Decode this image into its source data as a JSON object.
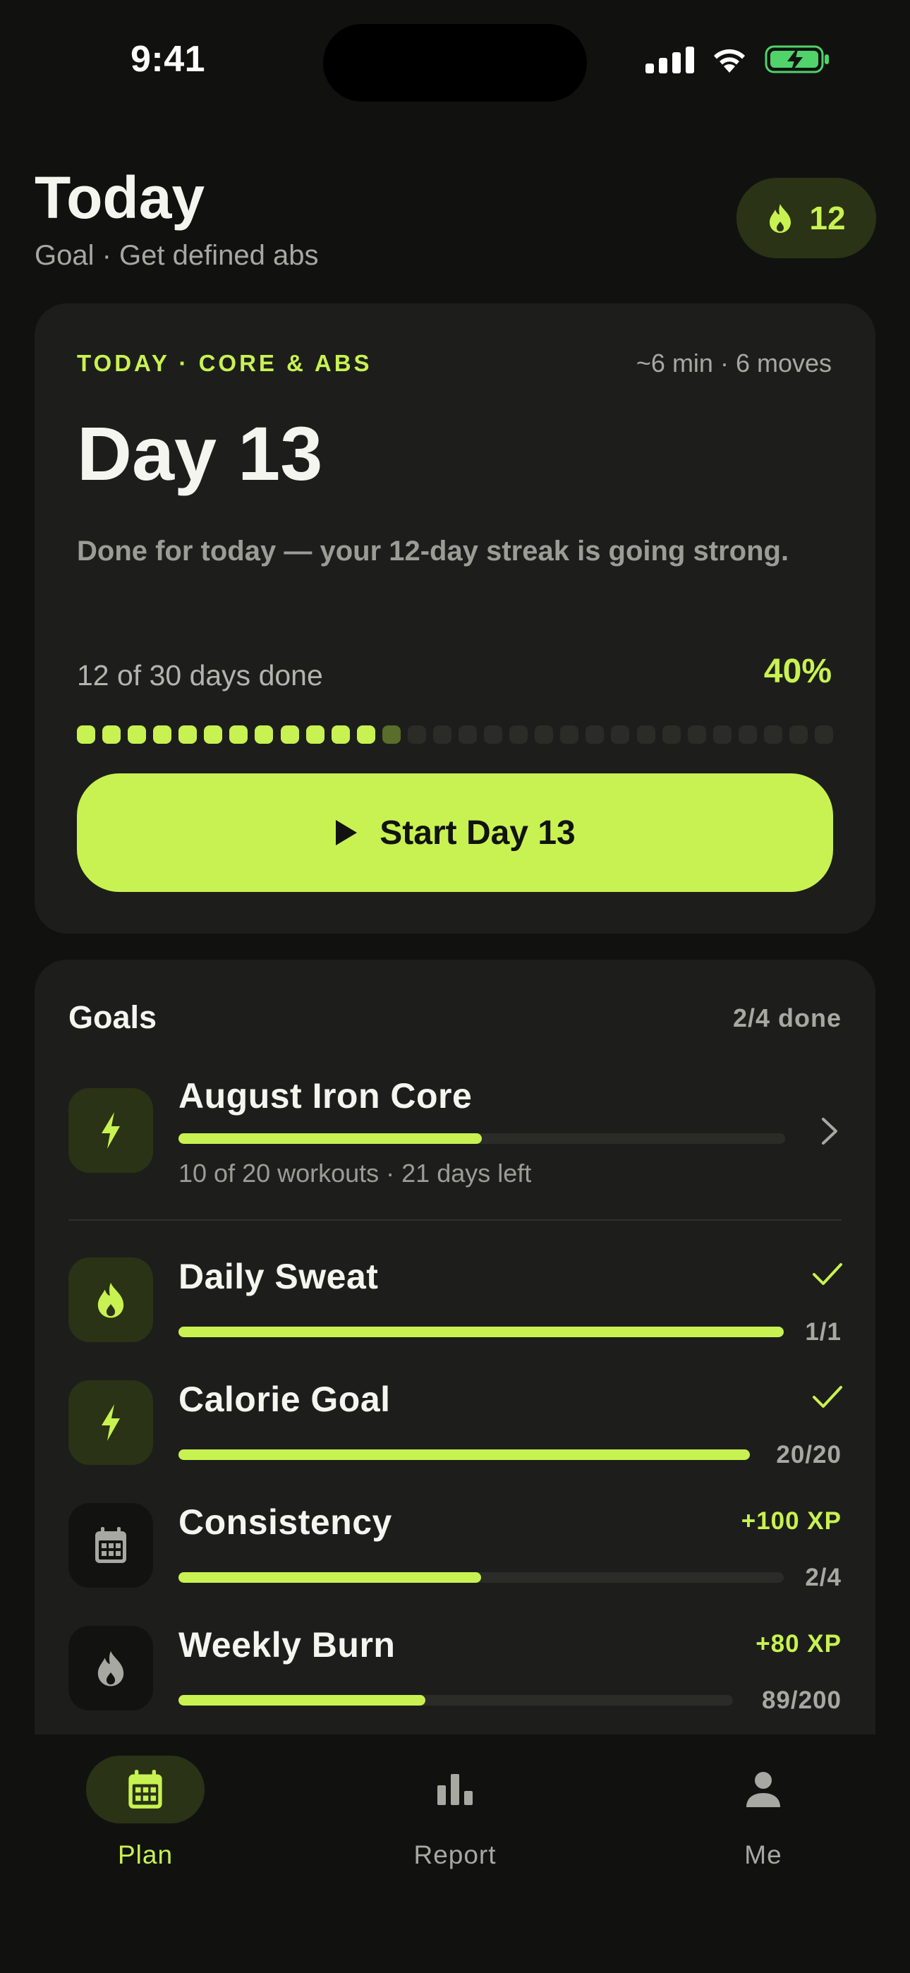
{
  "status_bar": {
    "time": "9:41"
  },
  "header": {
    "title": "Today",
    "subtitle": "Goal · Get defined abs",
    "streak_count": "12"
  },
  "today_card": {
    "eyebrow": "TODAY · CORE & ABS",
    "meta": "~6 min · 6 moves",
    "day_title": "Day 13",
    "description": "Done for today — your 12-day streak is going strong.",
    "progress_label": "12 of 30 days done",
    "progress_percent": "40%",
    "days_done": 12,
    "days_total": 30,
    "current_day": 13,
    "start_button_label": "Start Day 13"
  },
  "goals": {
    "title": "Goals",
    "count_label": "2/4 done",
    "featured": {
      "name": "August Iron Core",
      "progress": 0.5,
      "subtitle": "10 of 20 workouts · 21 days left",
      "icon": "bolt-icon"
    },
    "items": [
      {
        "name": "Daily Sweat",
        "progress": 1.0,
        "fraction": "1/1",
        "status": "check",
        "icon": "flame-icon"
      },
      {
        "name": "Calorie Goal",
        "progress": 1.0,
        "fraction": "20/20",
        "status": "check",
        "icon": "bolt-icon"
      },
      {
        "name": "Consistency",
        "progress": 0.5,
        "fraction": "2/4",
        "reward": "+100 XP",
        "icon": "calendar-icon"
      },
      {
        "name": "Weekly Burn",
        "progress": 0.445,
        "fraction": "89/200",
        "reward": "+80 XP",
        "icon": "flame-icon"
      }
    ]
  },
  "tabs": [
    {
      "label": "Plan",
      "icon": "calendar-icon",
      "active": true
    },
    {
      "label": "Report",
      "icon": "bar-chart-icon",
      "active": false
    },
    {
      "label": "Me",
      "icon": "person-icon",
      "active": false
    }
  ],
  "colors": {
    "background": "#111210",
    "card": "#1d1e1b",
    "accent": "#c8f251",
    "accent_dim": "#2a3315",
    "muted_text": "#a8a8a2"
  }
}
